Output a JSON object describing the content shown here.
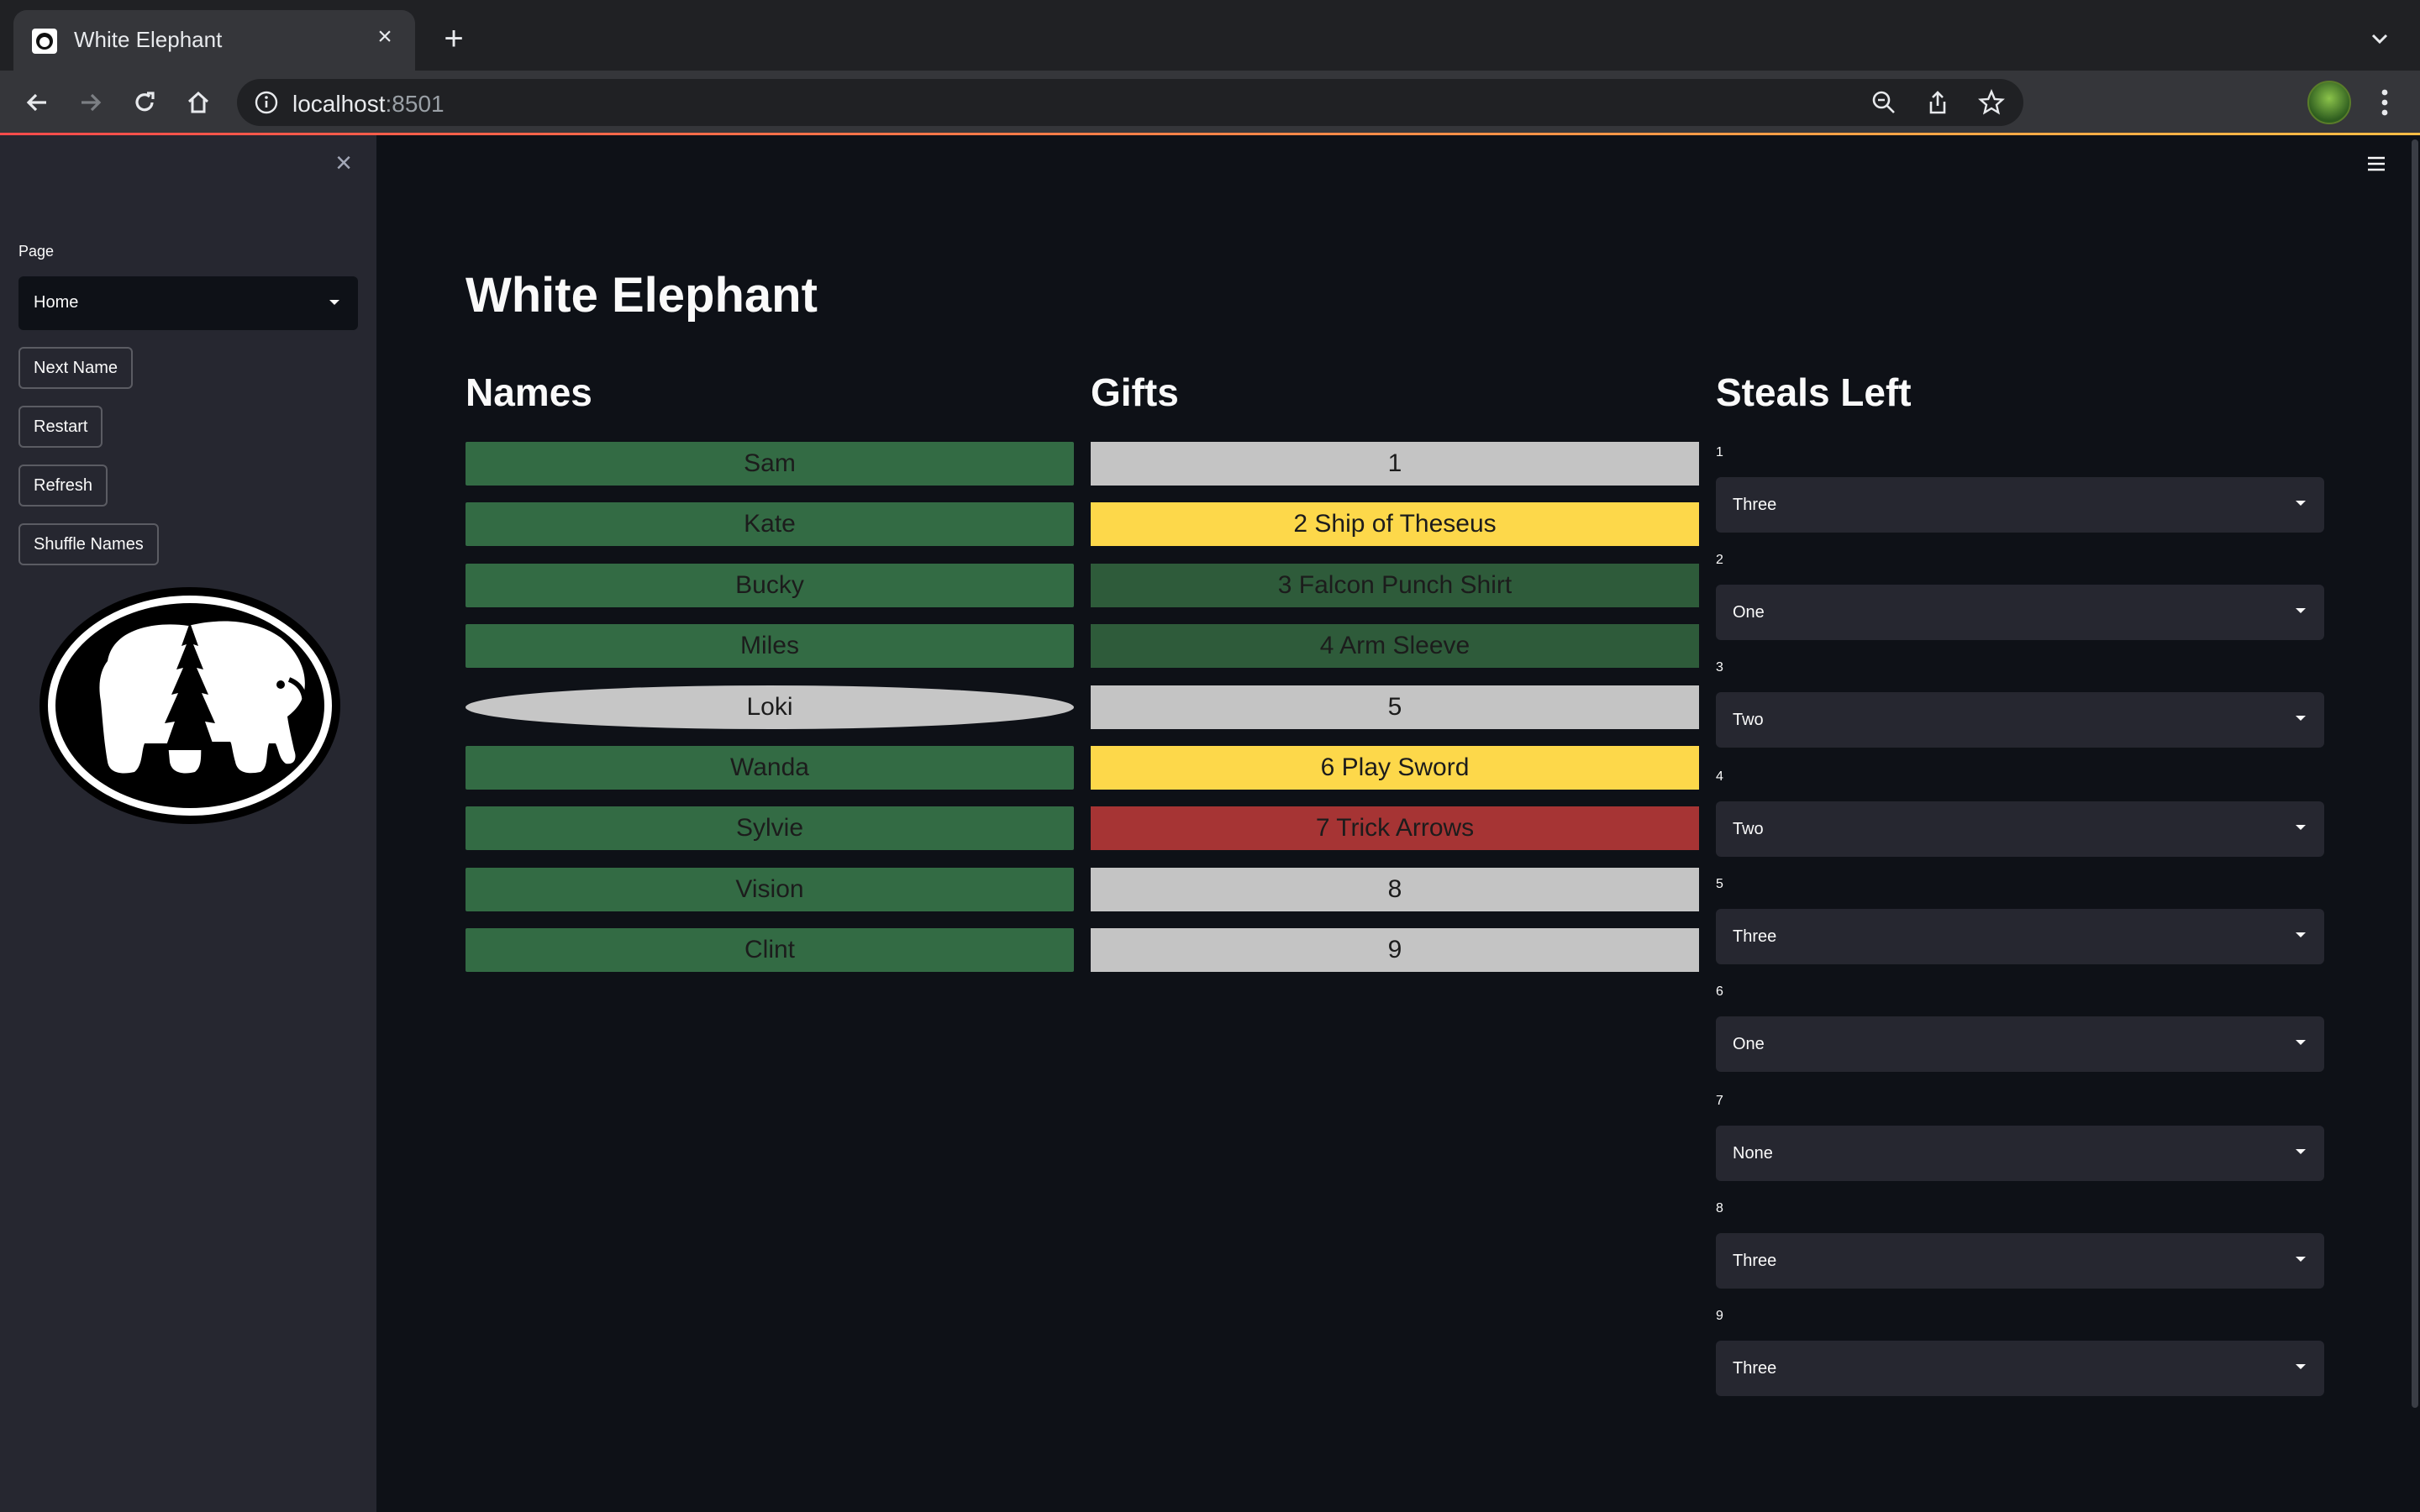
{
  "browser": {
    "tab_title": "White Elephant",
    "url_host": "localhost",
    "url_port": ":8501"
  },
  "sidebar": {
    "page_label": "Page",
    "page_value": "Home",
    "buttons": {
      "next_name": "Next Name",
      "restart": "Restart",
      "refresh": "Refresh",
      "shuffle": "Shuffle Names"
    }
  },
  "main": {
    "title": "White Elephant",
    "headers": {
      "names": "Names",
      "gifts": "Gifts",
      "steals": "Steals Left"
    },
    "names": [
      "Sam",
      "Kate",
      "Bucky",
      "Miles",
      "Loki",
      "Wanda",
      "Sylvie",
      "Vision",
      "Clint"
    ],
    "gifts": [
      {
        "label": "1",
        "status_color": "#c4c4c4"
      },
      {
        "label": "2 Ship of Theseus",
        "status_color": "#fdd84a"
      },
      {
        "label": "3 Falcon Punch Shirt",
        "status_color": "#2e5b3a"
      },
      {
        "label": "4 Arm Sleeve",
        "status_color": "#2e5b3a"
      },
      {
        "label": "5",
        "status_color": "#c4c4c4"
      },
      {
        "label": "6 Play Sword",
        "status_color": "#fdd84a"
      },
      {
        "label": "7 Trick Arrows",
        "status_color": "#a63434"
      },
      {
        "label": "8",
        "status_color": "#c4c4c4"
      },
      {
        "label": "9",
        "status_color": "#c4c4c4"
      }
    ],
    "steals": [
      {
        "label": "1",
        "value": "Three"
      },
      {
        "label": "2",
        "value": "One"
      },
      {
        "label": "3",
        "value": "Two"
      },
      {
        "label": "4",
        "value": "Two"
      },
      {
        "label": "5",
        "value": "Three"
      },
      {
        "label": "6",
        "value": "One"
      },
      {
        "label": "7",
        "value": "None"
      },
      {
        "label": "8",
        "value": "Three"
      },
      {
        "label": "9",
        "value": "Three"
      }
    ]
  },
  "colors": {
    "name_green": "#336b44",
    "highlight_gray": "#c6c6c6",
    "background": "#0e1117",
    "sidebar": "#262730"
  }
}
